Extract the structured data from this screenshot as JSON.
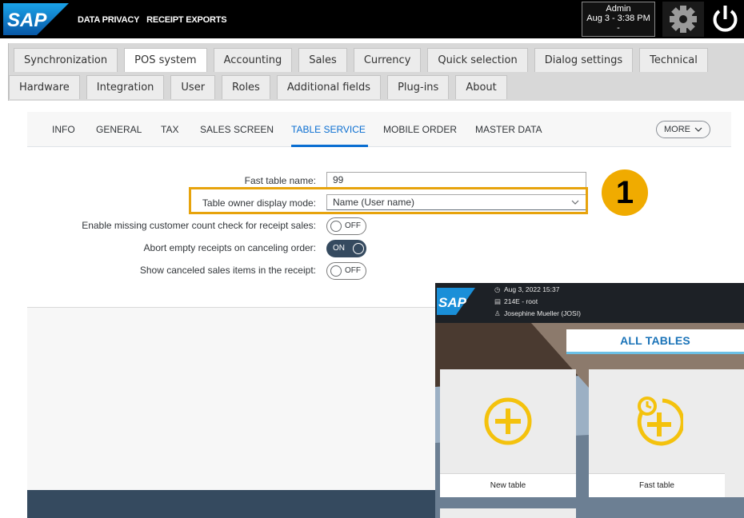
{
  "header": {
    "links": [
      "DATA PRIVACY",
      "RECEIPT EXPORTS"
    ],
    "user": "Admin",
    "datetime": "Aug 3 - 3:38 PM",
    "extra": "-"
  },
  "tabs_row1": [
    "Synchronization",
    "POS system",
    "Accounting",
    "Sales",
    "Currency",
    "Quick selection",
    "Dialog settings",
    "Technical"
  ],
  "tabs_row2": [
    "Hardware",
    "Integration",
    "User",
    "Roles",
    "Additional fields",
    "Plug-ins",
    "About"
  ],
  "active_tab": "POS system",
  "subnav": {
    "items": [
      "INFO",
      "GENERAL",
      "TAX",
      "SALES SCREEN",
      "TABLE SERVICE",
      "MOBILE ORDER",
      "MASTER DATA"
    ],
    "active": "TABLE SERVICE",
    "more_label": "MORE"
  },
  "form": {
    "fast_table_label": "Fast table name:",
    "fast_table_value": "99",
    "owner_mode_label": "Table owner display mode:",
    "owner_mode_value": "Name (User name)",
    "missing_count_label": "Enable missing customer count check for receipt sales:",
    "missing_count_state": "OFF",
    "abort_empty_label": "Abort empty receipts on canceling order:",
    "abort_empty_state": "ON",
    "show_canceled_label": "Show canceled sales items in the receipt:",
    "show_canceled_state": "OFF"
  },
  "callout_number": "1",
  "colors": {
    "accent": "#0a6ed1",
    "highlight": "#e7a30c",
    "callout": "#f0ab00",
    "toggle_on": "#354a5f",
    "plus_icon": "#f4c20d"
  },
  "inset": {
    "datetime": "Aug 3, 2022 15:37",
    "register": "214E - root",
    "user": "Josephine Mueller (JOSI)",
    "section_title": "ALL TABLES",
    "tiles": [
      {
        "label": "New table",
        "icon": "plus-circle-icon"
      },
      {
        "label": "Fast table",
        "icon": "fast-plus-icon"
      }
    ]
  }
}
